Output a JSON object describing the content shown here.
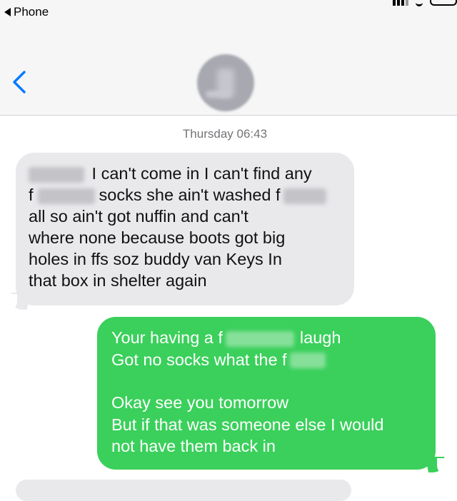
{
  "status_bar": {
    "back_app_label": "Phone",
    "icons": [
      "signal-icon",
      "wifi-icon",
      "battery-icon"
    ]
  },
  "header": {
    "back_icon": "chevron-left-icon",
    "avatar": "contact-avatar-blurred",
    "contact_name": "",
    "accent_color": "#007aff"
  },
  "thread": {
    "timestamp": "Thursday 06:43",
    "incoming": {
      "color": "#e9e9ec",
      "lines": [
        {
          "a": "I can't come in I can't find any"
        },
        {
          "a": "f",
          "b": "socks she ain't washed f"
        },
        {
          "a": "all so ain't got nuffin and can't"
        },
        {
          "a": "where none because boots got big"
        },
        {
          "a": "holes in ffs soz buddy van Keys In"
        },
        {
          "a": "that box in shelter again"
        }
      ]
    },
    "outgoing": {
      "color": "#3ad05b",
      "lines": [
        {
          "a": "Your having a f",
          "b": "laugh"
        },
        {
          "a": "Got no socks what the f"
        },
        {
          "a": ""
        },
        {
          "a": "Okay see you tomorrow"
        },
        {
          "a": "But if that was someone else I would"
        },
        {
          "a": "not  have them back in"
        }
      ]
    }
  }
}
